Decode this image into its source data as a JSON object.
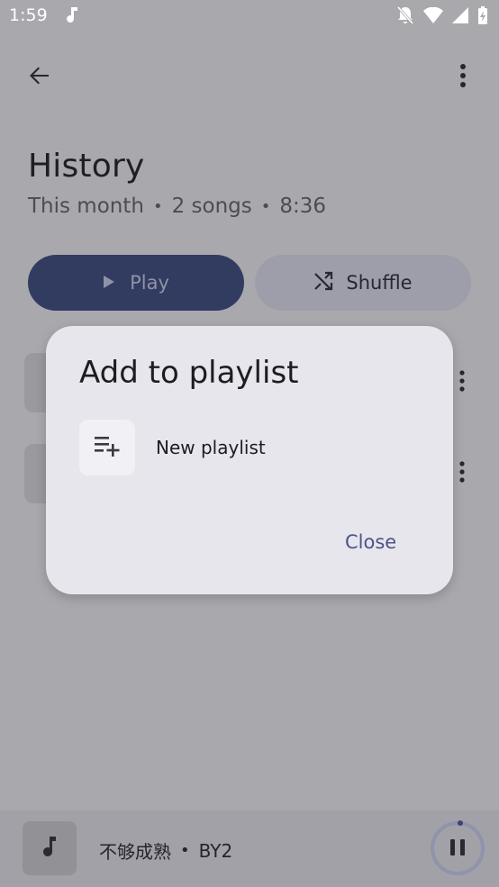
{
  "status_bar": {
    "time": "1:59",
    "music_icon": "music-note-icon"
  },
  "header": {
    "back_icon": "arrow-back-icon",
    "more_icon": "more-vert-icon"
  },
  "playlist": {
    "title": "History",
    "period": "This month",
    "song_count": "2 songs",
    "duration": "8:36"
  },
  "actions": {
    "play_label": "Play",
    "shuffle_label": "Shuffle"
  },
  "dialog": {
    "title": "Add to playlist",
    "new_playlist_label": "New playlist",
    "close_label": "Close"
  },
  "mini_player": {
    "song": "不够成熟",
    "artist": "BY2"
  },
  "colors": {
    "play_button": "#323b60",
    "shuffle_button": "#9e9eab",
    "dialog_bg": "#e8e6ed",
    "accent_text": "#4b5589"
  }
}
